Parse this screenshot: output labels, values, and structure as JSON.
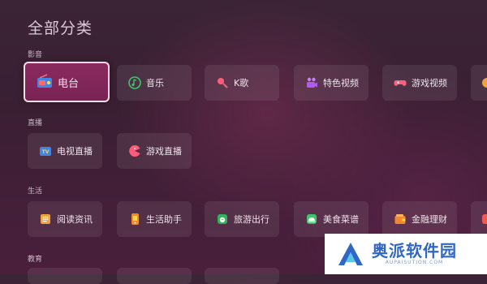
{
  "header": {
    "title": "全部分类"
  },
  "sections": {
    "media": {
      "label": "影音"
    },
    "live": {
      "label": "直播"
    },
    "life": {
      "label": "生活"
    },
    "education": {
      "label": "教育"
    }
  },
  "tiles": {
    "radio": "电台",
    "music": "音乐",
    "karaoke": "K歌",
    "featured_video": "特色视频",
    "game_video": "游戏视频",
    "tv_live": "电视直播",
    "game_live": "游戏直播",
    "reading_news": "阅读资讯",
    "life_assistant": "生活助手",
    "travel": "旅游出行",
    "food_recipes": "美食菜谱",
    "finance": "金融理财"
  },
  "watermark": {
    "text": "奥派软件园",
    "url": "AUPAISUTION.COM"
  }
}
